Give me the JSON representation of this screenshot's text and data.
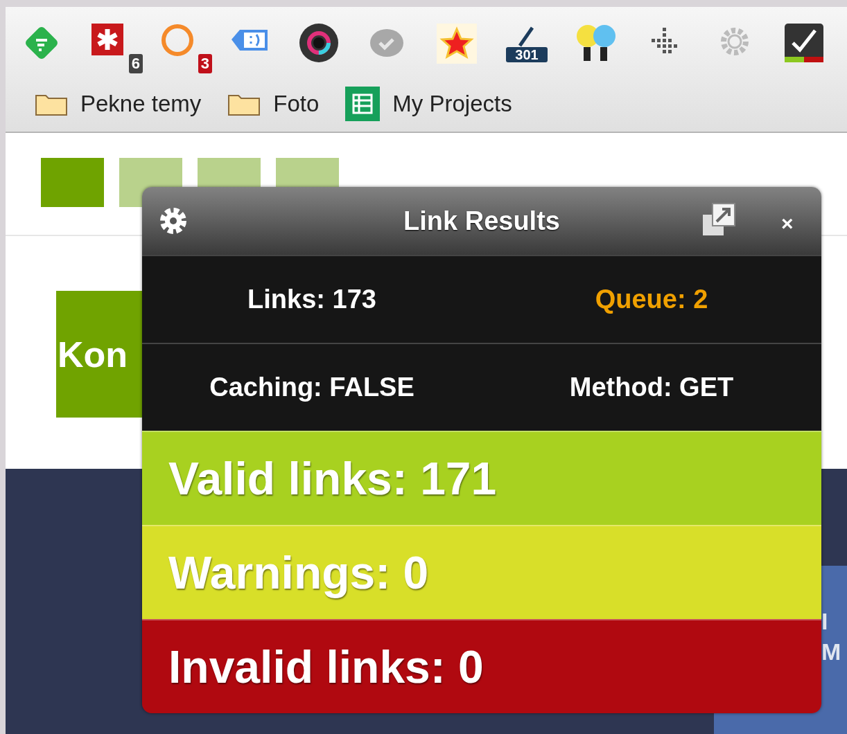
{
  "toolbar_icons": [
    {
      "kind": "feed"
    },
    {
      "kind": "asterisk",
      "badge": "6"
    },
    {
      "kind": "ring",
      "badge": "3"
    },
    {
      "kind": "tag"
    },
    {
      "kind": "lens"
    },
    {
      "kind": "check"
    },
    {
      "kind": "star"
    },
    {
      "kind": "sign",
      "badge": "301"
    },
    {
      "kind": "bulbs"
    },
    {
      "kind": "dots"
    },
    {
      "kind": "cog"
    },
    {
      "kind": "tick"
    }
  ],
  "bookmarks": [
    {
      "kind": "folder",
      "label": "Pekne temy"
    },
    {
      "kind": "folder",
      "label": "Foto"
    },
    {
      "kind": "sheet",
      "label": "My Projects"
    }
  ],
  "pager": [
    {
      "selected": true
    },
    {
      "selected": false
    },
    {
      "selected": false
    },
    {
      "selected": false
    }
  ],
  "page": {
    "banner": "Kon",
    "side_lines": [
      "I",
      "M"
    ]
  },
  "popup": {
    "title": "Link Results",
    "close": "×",
    "stats": [
      {
        "label": "Links: 173",
        "color": "#ffffff"
      },
      {
        "label": "Queue: 2",
        "color": "#f0a000"
      },
      {
        "label": "Caching: FALSE",
        "color": "#ffffff"
      },
      {
        "label": "Method: GET",
        "color": "#ffffff"
      }
    ],
    "results": [
      {
        "kind": "valid",
        "label": "Valid links: 171"
      },
      {
        "kind": "warning",
        "label": "Warnings: 0"
      },
      {
        "kind": "invalid",
        "label": "Invalid links: 0"
      }
    ]
  }
}
